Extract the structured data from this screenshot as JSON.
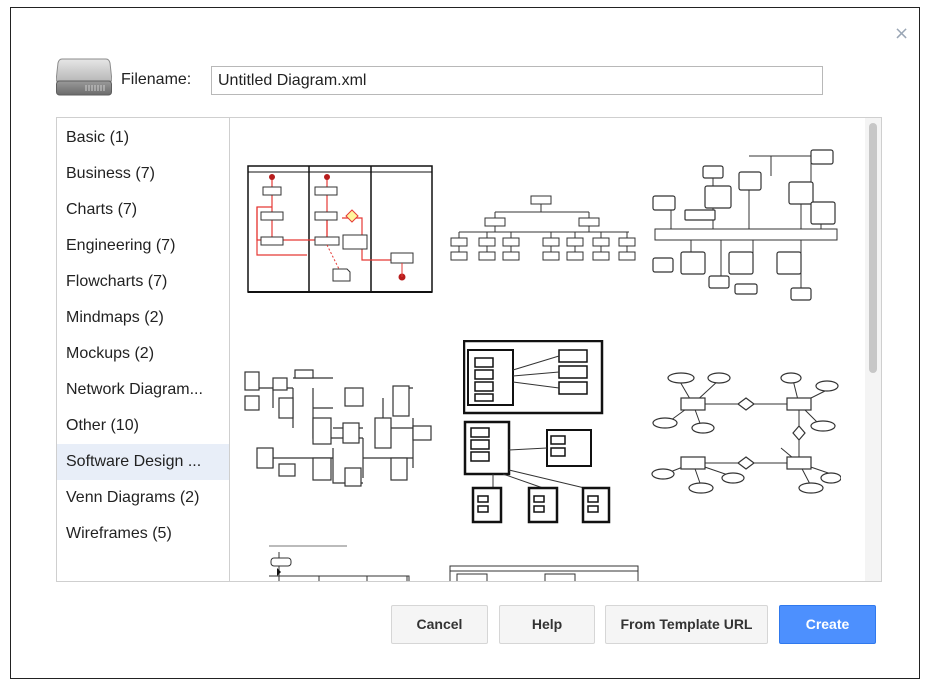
{
  "dialog": {
    "close_label": "×",
    "filename_label": "Filename:",
    "filename_value": "Untitled Diagram.xml"
  },
  "categories": [
    {
      "label": "Basic (1)"
    },
    {
      "label": "Business (7)"
    },
    {
      "label": "Charts (7)"
    },
    {
      "label": "Engineering (7)"
    },
    {
      "label": "Flowcharts (7)"
    },
    {
      "label": "Mindmaps (2)"
    },
    {
      "label": "Mockups (2)"
    },
    {
      "label": "Network Diagram..."
    },
    {
      "label": "Other (10)"
    },
    {
      "label": "Software Design ...",
      "selected": true
    },
    {
      "label": "Venn Diagrams (2)"
    },
    {
      "label": "Wireframes (5)"
    }
  ],
  "templates": [
    {
      "kind": "activity-diagram-swimlanes"
    },
    {
      "kind": "tree-hierarchy"
    },
    {
      "kind": "component-network"
    },
    {
      "kind": "block-flowchart"
    },
    {
      "kind": "uml-component-packages"
    },
    {
      "kind": "entity-relationship"
    },
    {
      "kind": "sequence-partial"
    },
    {
      "kind": "class-partial"
    }
  ],
  "buttons": {
    "cancel": "Cancel",
    "help": "Help",
    "from_template_url": "From Template URL",
    "create": "Create"
  },
  "colors": {
    "accent": "#4d90fe",
    "selected_row": "#e8eef8",
    "highlight_line": "#e53935"
  }
}
